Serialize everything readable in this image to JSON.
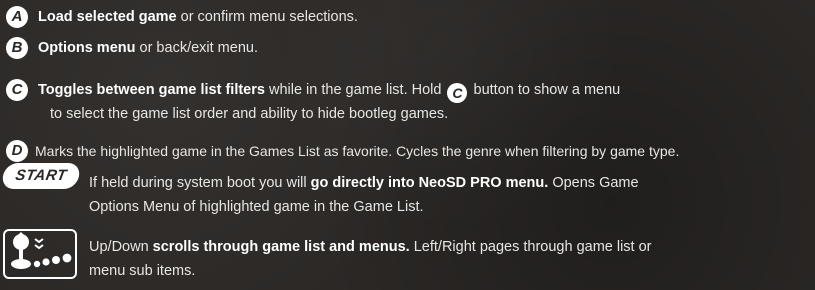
{
  "entries": {
    "a": {
      "badge": "A",
      "bold": "Load selected game",
      "rest": " or confirm menu selections."
    },
    "b": {
      "badge": "B",
      "bold": "Options menu",
      "rest": " or back/exit menu."
    },
    "c": {
      "badge": "C",
      "bold": "Toggles between game list filters",
      "rest1": " while in the game list.  Hold ",
      "inline_badge": "C",
      "rest2": " button to show a menu",
      "line2": "to select the game list order and ability to hide bootleg games."
    },
    "d": {
      "badge": "D",
      "text": "Marks the highlighted game in the Games List as favorite. Cycles the genre when filtering by game type."
    },
    "start": {
      "badge": "START",
      "pre": "If held during system boot you will ",
      "bold": "go directly into NeoSD PRO menu.",
      "post": " Opens Game",
      "line2": "Options Menu of highlighted game in the Game List."
    },
    "stick": {
      "icon": "joystick-buttons-icon",
      "pre": "Up/Down ",
      "bold": "scrolls through game list and menus.",
      "post": " Left/Right pages through game list or",
      "line2": "menu sub items."
    }
  }
}
